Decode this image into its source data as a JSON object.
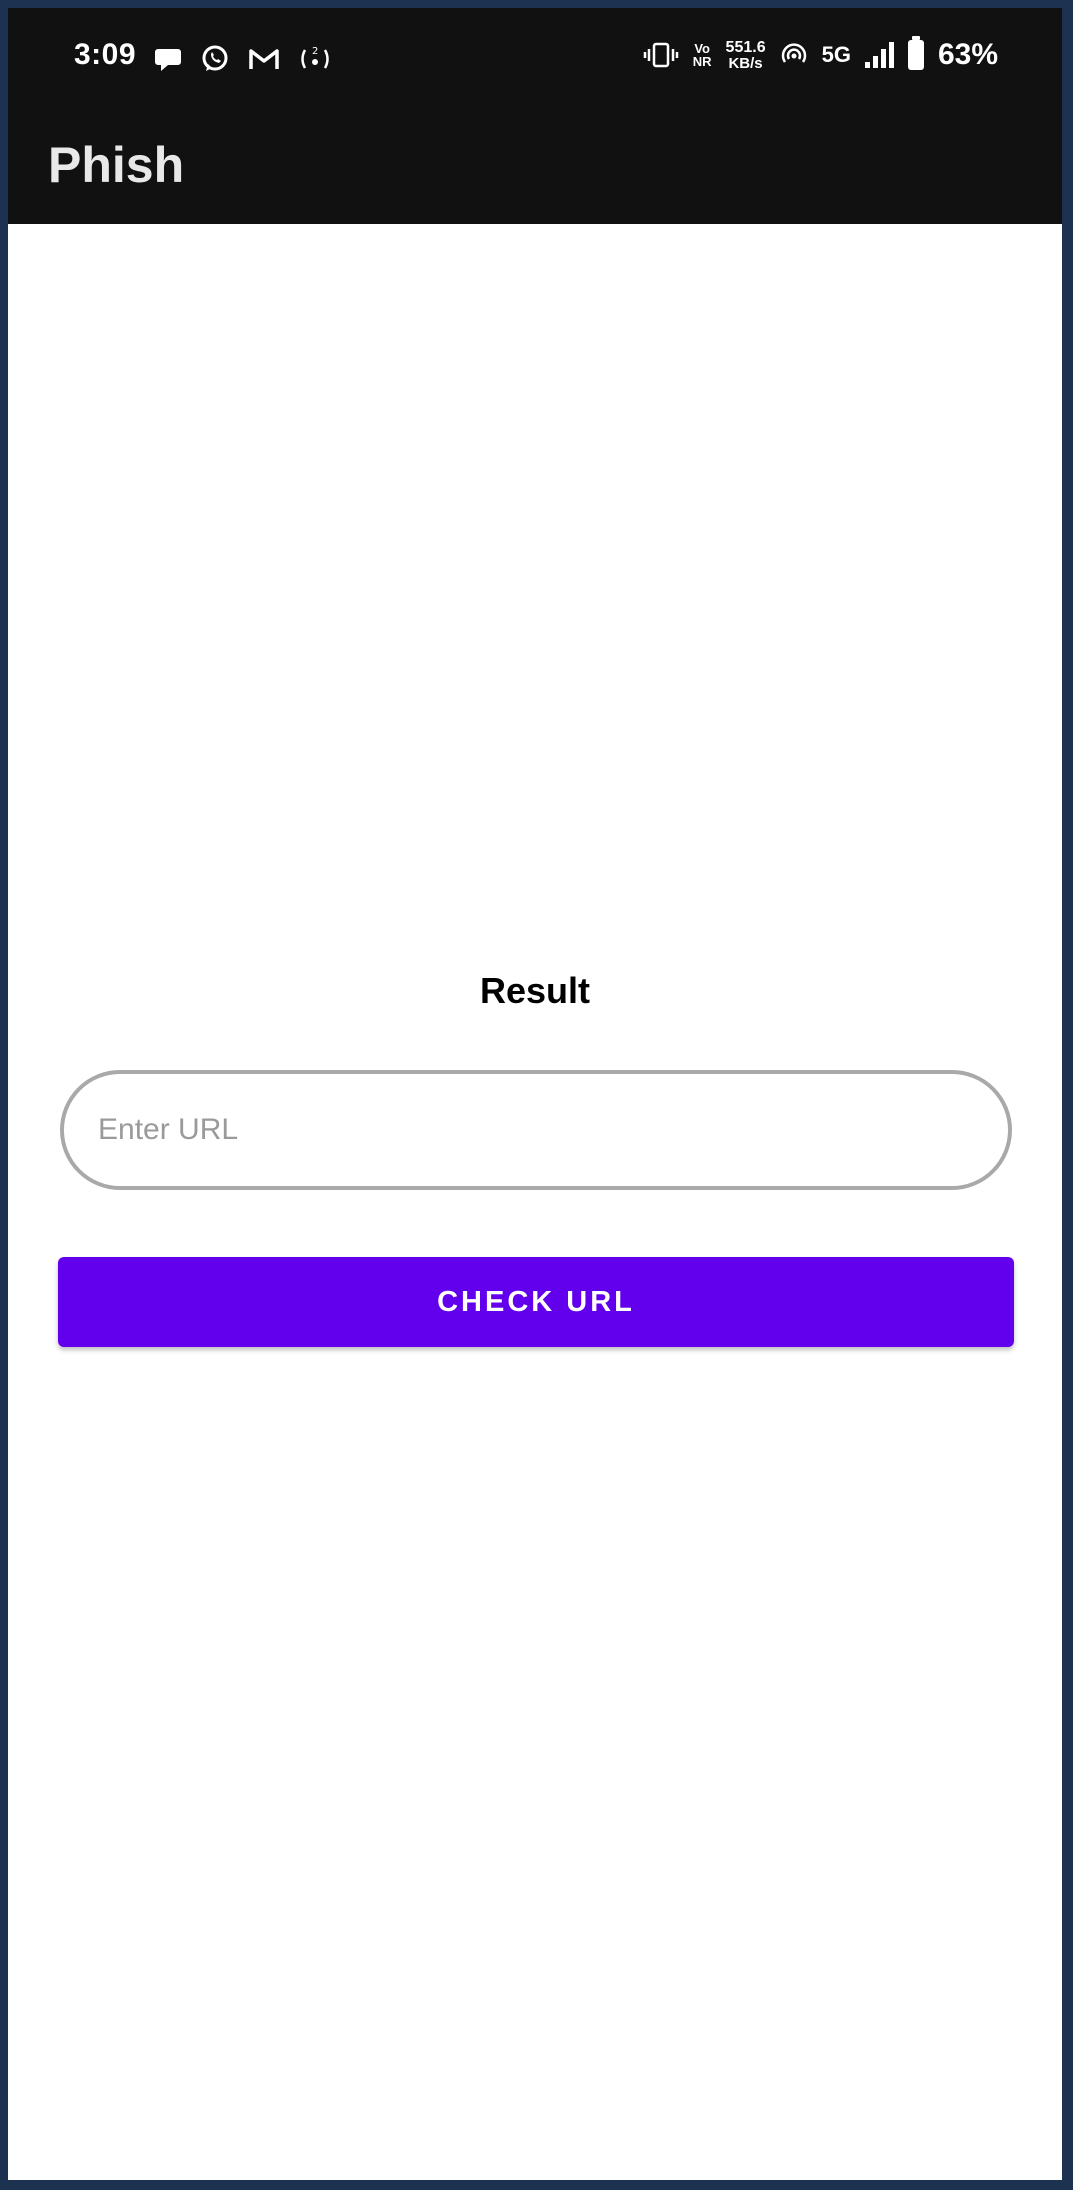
{
  "status_bar": {
    "time": "3:09",
    "vo_top": "Vo",
    "vo_bottom": "NR",
    "speed_value": "551.6",
    "speed_unit": "KB/s",
    "network": "5G",
    "battery_percent": "63%",
    "left_icons": [
      "chat-bubble-icon",
      "whatsapp-icon",
      "gmail-icon",
      "hotspot-icon"
    ],
    "right_icons": [
      "vibrate-icon",
      "volte-icon",
      "hotspot-wifi-icon",
      "signal-icon",
      "battery-icon"
    ]
  },
  "app_bar": {
    "title": "Phish"
  },
  "main": {
    "result_label": "Result",
    "url_input": {
      "placeholder": "Enter URL",
      "value": ""
    },
    "check_button_label": "CHECK URL"
  },
  "colors": {
    "bar_background": "#111111",
    "accent": "#6200ee",
    "frame": "#1c3250",
    "input_border": "#a9a9a9"
  }
}
